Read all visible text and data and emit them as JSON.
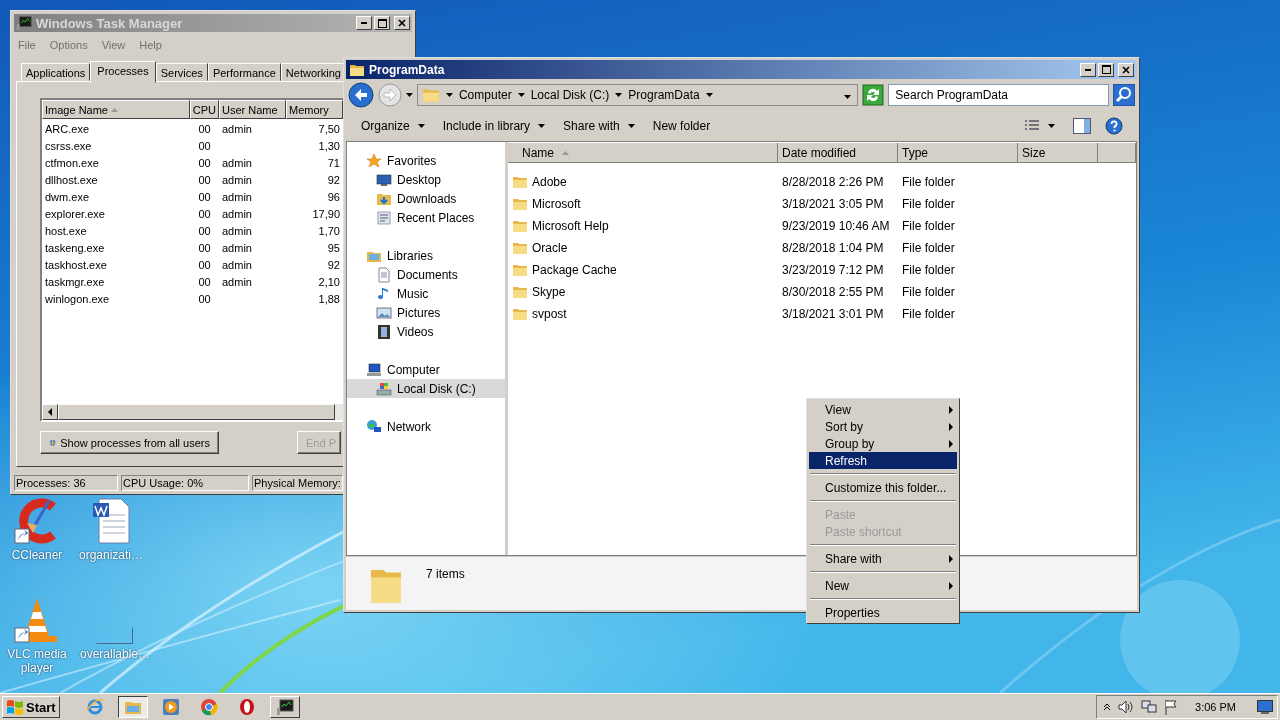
{
  "task_manager": {
    "title": "Windows Task Manager",
    "menu": [
      "File",
      "Options",
      "View",
      "Help"
    ],
    "tabs": [
      {
        "label": "Applications",
        "selected": false
      },
      {
        "label": "Processes",
        "selected": true
      },
      {
        "label": "Services",
        "selected": false
      },
      {
        "label": "Performance",
        "selected": false
      },
      {
        "label": "Networking",
        "selected": false
      }
    ],
    "columns": [
      {
        "label": "Image Name",
        "sorted": true
      },
      {
        "label": "CPU",
        "sorted": false
      },
      {
        "label": "User Name",
        "sorted": false
      },
      {
        "label": "Memory",
        "sorted": false
      }
    ],
    "rows": [
      {
        "image": "ARC.exe",
        "cpu": "00",
        "user": "admin",
        "memory": "7,50"
      },
      {
        "image": "csrss.exe",
        "cpu": "00",
        "memory": "1,30"
      },
      {
        "image": "ctfmon.exe",
        "cpu": "00",
        "user": "admin",
        "memory": "71"
      },
      {
        "image": "dllhost.exe",
        "cpu": "00",
        "user": "admin",
        "memory": "92"
      },
      {
        "image": "dwm.exe",
        "cpu": "00",
        "user": "admin",
        "memory": "96"
      },
      {
        "image": "explorer.exe",
        "cpu": "00",
        "user": "admin",
        "memory": "17,90"
      },
      {
        "image": "host.exe",
        "cpu": "00",
        "user": "admin",
        "memory": "1,70"
      },
      {
        "image": "taskeng.exe",
        "cpu": "00",
        "user": "admin",
        "memory": "95"
      },
      {
        "image": "taskhost.exe",
        "cpu": "00",
        "user": "admin",
        "memory": "92"
      },
      {
        "image": "taskmgr.exe",
        "cpu": "00",
        "user": "admin",
        "memory": "2,10"
      },
      {
        "image": "winlogon.exe",
        "cpu": "00",
        "memory": "1,88"
      }
    ],
    "buttons": [
      {
        "label": "Show processes from all users",
        "disabled": false
      },
      {
        "label": "End P",
        "disabled": true
      }
    ],
    "status": [
      "Processes: 36",
      "CPU Usage: 0%",
      "Physical Memory:"
    ]
  },
  "explorer": {
    "title": "ProgramData",
    "breadcrumb": [
      "Computer",
      "Local Disk (C:)",
      "ProgramData"
    ],
    "search": {
      "placeholder": "Search ProgramData"
    },
    "toolbar": [
      {
        "label": "Organize",
        "dropdown": true
      },
      {
        "label": "Include in library",
        "dropdown": true
      },
      {
        "label": "Share with",
        "dropdown": true
      },
      {
        "label": "New folder",
        "dropdown": false
      }
    ],
    "nav": [
      {
        "label": "Favorites",
        "kind": "star",
        "selected": false,
        "children": [
          {
            "label": "Desktop",
            "kind": "desktop",
            "selected": false
          },
          {
            "label": "Downloads",
            "kind": "download",
            "selected": false
          },
          {
            "label": "Recent Places",
            "kind": "recent",
            "selected": false
          }
        ]
      },
      {
        "label": "Libraries",
        "kind": "library",
        "selected": false,
        "children": [
          {
            "label": "Documents",
            "kind": "document",
            "selected": false
          },
          {
            "label": "Music",
            "kind": "music",
            "selected": false
          },
          {
            "label": "Pictures",
            "kind": "picture",
            "selected": false
          },
          {
            "label": "Videos",
            "kind": "video",
            "selected": false
          }
        ]
      },
      {
        "label": "Computer",
        "kind": "computer",
        "selected": false,
        "children": [
          {
            "label": "Local Disk (C:)",
            "kind": "disk",
            "selected": true
          }
        ]
      },
      {
        "label": "Network",
        "kind": "network",
        "selected": false
      }
    ],
    "columns": [
      {
        "label": "Name",
        "sorted": true
      },
      {
        "label": "Date modified",
        "sorted": false
      },
      {
        "label": "Type",
        "sorted": false
      },
      {
        "label": "Size",
        "sorted": false
      }
    ],
    "files": [
      {
        "name": "Adobe",
        "date": "8/28/2018 2:26 PM",
        "type": "File folder"
      },
      {
        "name": "Microsoft",
        "date": "3/18/2021 3:05 PM",
        "type": "File folder"
      },
      {
        "name": "Microsoft Help",
        "date": "9/23/2019 10:46 AM",
        "type": "File folder"
      },
      {
        "name": "Oracle",
        "date": "8/28/2018 1:04 PM",
        "type": "File folder"
      },
      {
        "name": "Package Cache",
        "date": "3/23/2019 7:12 PM",
        "type": "File folder"
      },
      {
        "name": "Skype",
        "date": "8/30/2018 2:55 PM",
        "type": "File folder"
      },
      {
        "name": "svpost",
        "date": "3/18/2021 3:01 PM",
        "type": "File folder"
      }
    ],
    "status": "7 items"
  },
  "context_menu": {
    "items": [
      {
        "kind": "item",
        "label": "View",
        "submenu": true,
        "disabled": false,
        "selected": false
      },
      {
        "kind": "item",
        "label": "Sort by",
        "submenu": true,
        "disabled": false,
        "selected": false
      },
      {
        "kind": "item",
        "label": "Group by",
        "submenu": true,
        "disabled": false,
        "selected": false
      },
      {
        "kind": "item",
        "label": "Refresh",
        "submenu": false,
        "disabled": false,
        "selected": true
      },
      {
        "kind": "separator"
      },
      {
        "kind": "item",
        "label": "Customize this folder...",
        "submenu": false,
        "disabled": false,
        "selected": false
      },
      {
        "kind": "separator"
      },
      {
        "kind": "item",
        "label": "Paste",
        "submenu": false,
        "disabled": true,
        "selected": false
      },
      {
        "kind": "item",
        "label": "Paste shortcut",
        "submenu": false,
        "disabled": true,
        "selected": false
      },
      {
        "kind": "separator"
      },
      {
        "kind": "item",
        "label": "Share with",
        "submenu": true,
        "disabled": false,
        "selected": false
      },
      {
        "kind": "separator"
      },
      {
        "kind": "item",
        "label": "New",
        "submenu": true,
        "disabled": false,
        "selected": false
      },
      {
        "kind": "separator"
      },
      {
        "kind": "item",
        "label": "Properties",
        "submenu": false,
        "disabled": false,
        "selected": false
      }
    ]
  },
  "desktop_icons": [
    {
      "label": "CCleaner",
      "kind": "cleaner"
    },
    {
      "label": "organizati…",
      "kind": "document"
    },
    {
      "label": "VLC media player",
      "kind": "cone"
    },
    {
      "label": "overallable…",
      "kind": "blank"
    }
  ],
  "taskbar": {
    "start": "Start",
    "apps": [
      {
        "kind": "browser",
        "selected": false,
        "running": false
      },
      {
        "kind": "folder",
        "selected": true,
        "running": true
      },
      {
        "kind": "player",
        "selected": false,
        "running": false
      },
      {
        "kind": "chrome",
        "selected": false,
        "running": false
      },
      {
        "kind": "ring",
        "selected": false,
        "running": false
      },
      {
        "kind": "monitor",
        "selected": false,
        "running": true
      }
    ],
    "clock": "3:06 PM"
  }
}
